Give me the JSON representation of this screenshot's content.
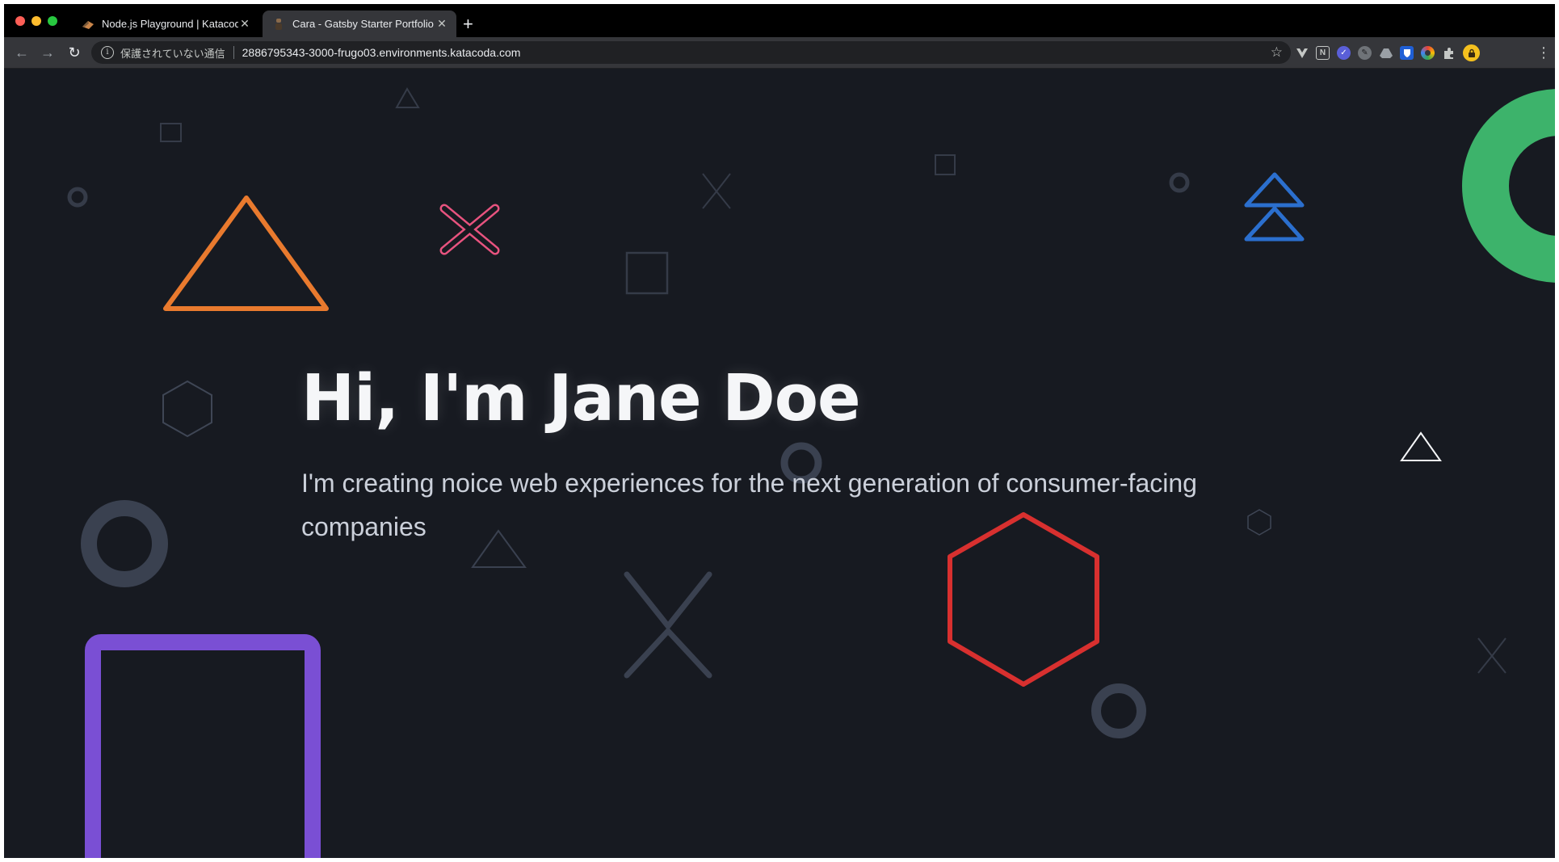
{
  "browser": {
    "tabs": [
      {
        "title": "Node.js Playground | Katacoda",
        "active": false,
        "favicon": "katacoda-icon"
      },
      {
        "title": "Cara - Gatsby Starter Portfolio",
        "active": true,
        "favicon": "cara-icon"
      }
    ],
    "close_glyph": "✕",
    "new_tab_glyph": "+",
    "nav": {
      "back_glyph": "←",
      "forward_glyph": "→",
      "reload_glyph": "↻"
    },
    "address_bar": {
      "info_glyph": "i",
      "security_text": "保護されていない通信",
      "url": "2886795343-3000-frugo03.environments.katacoda.com",
      "bookmark_glyph": "☆"
    },
    "extensions": [
      "vue-devtools-icon",
      "notion-icon",
      "task-check-icon",
      "feather-icon",
      "drive-icon",
      "bitwarden-icon",
      "color-picker-icon",
      "puzzle-extensions-icon",
      "profile-avatar-icon"
    ],
    "menu_glyph": "⋮"
  },
  "hero": {
    "title": "Hi, I'm Jane Doe",
    "subtitle": "I'm creating noice web experiences for the next generation of consumer-facing companies"
  },
  "colors": {
    "background": "#171a21",
    "orange": "#e97a2e",
    "pink": "#e8537f",
    "blue": "#2b6fce",
    "green": "#3db36b",
    "red": "#d8302f",
    "purple": "#7a4fd4",
    "muted": "#3a4150",
    "white": "#f5f6f8"
  }
}
